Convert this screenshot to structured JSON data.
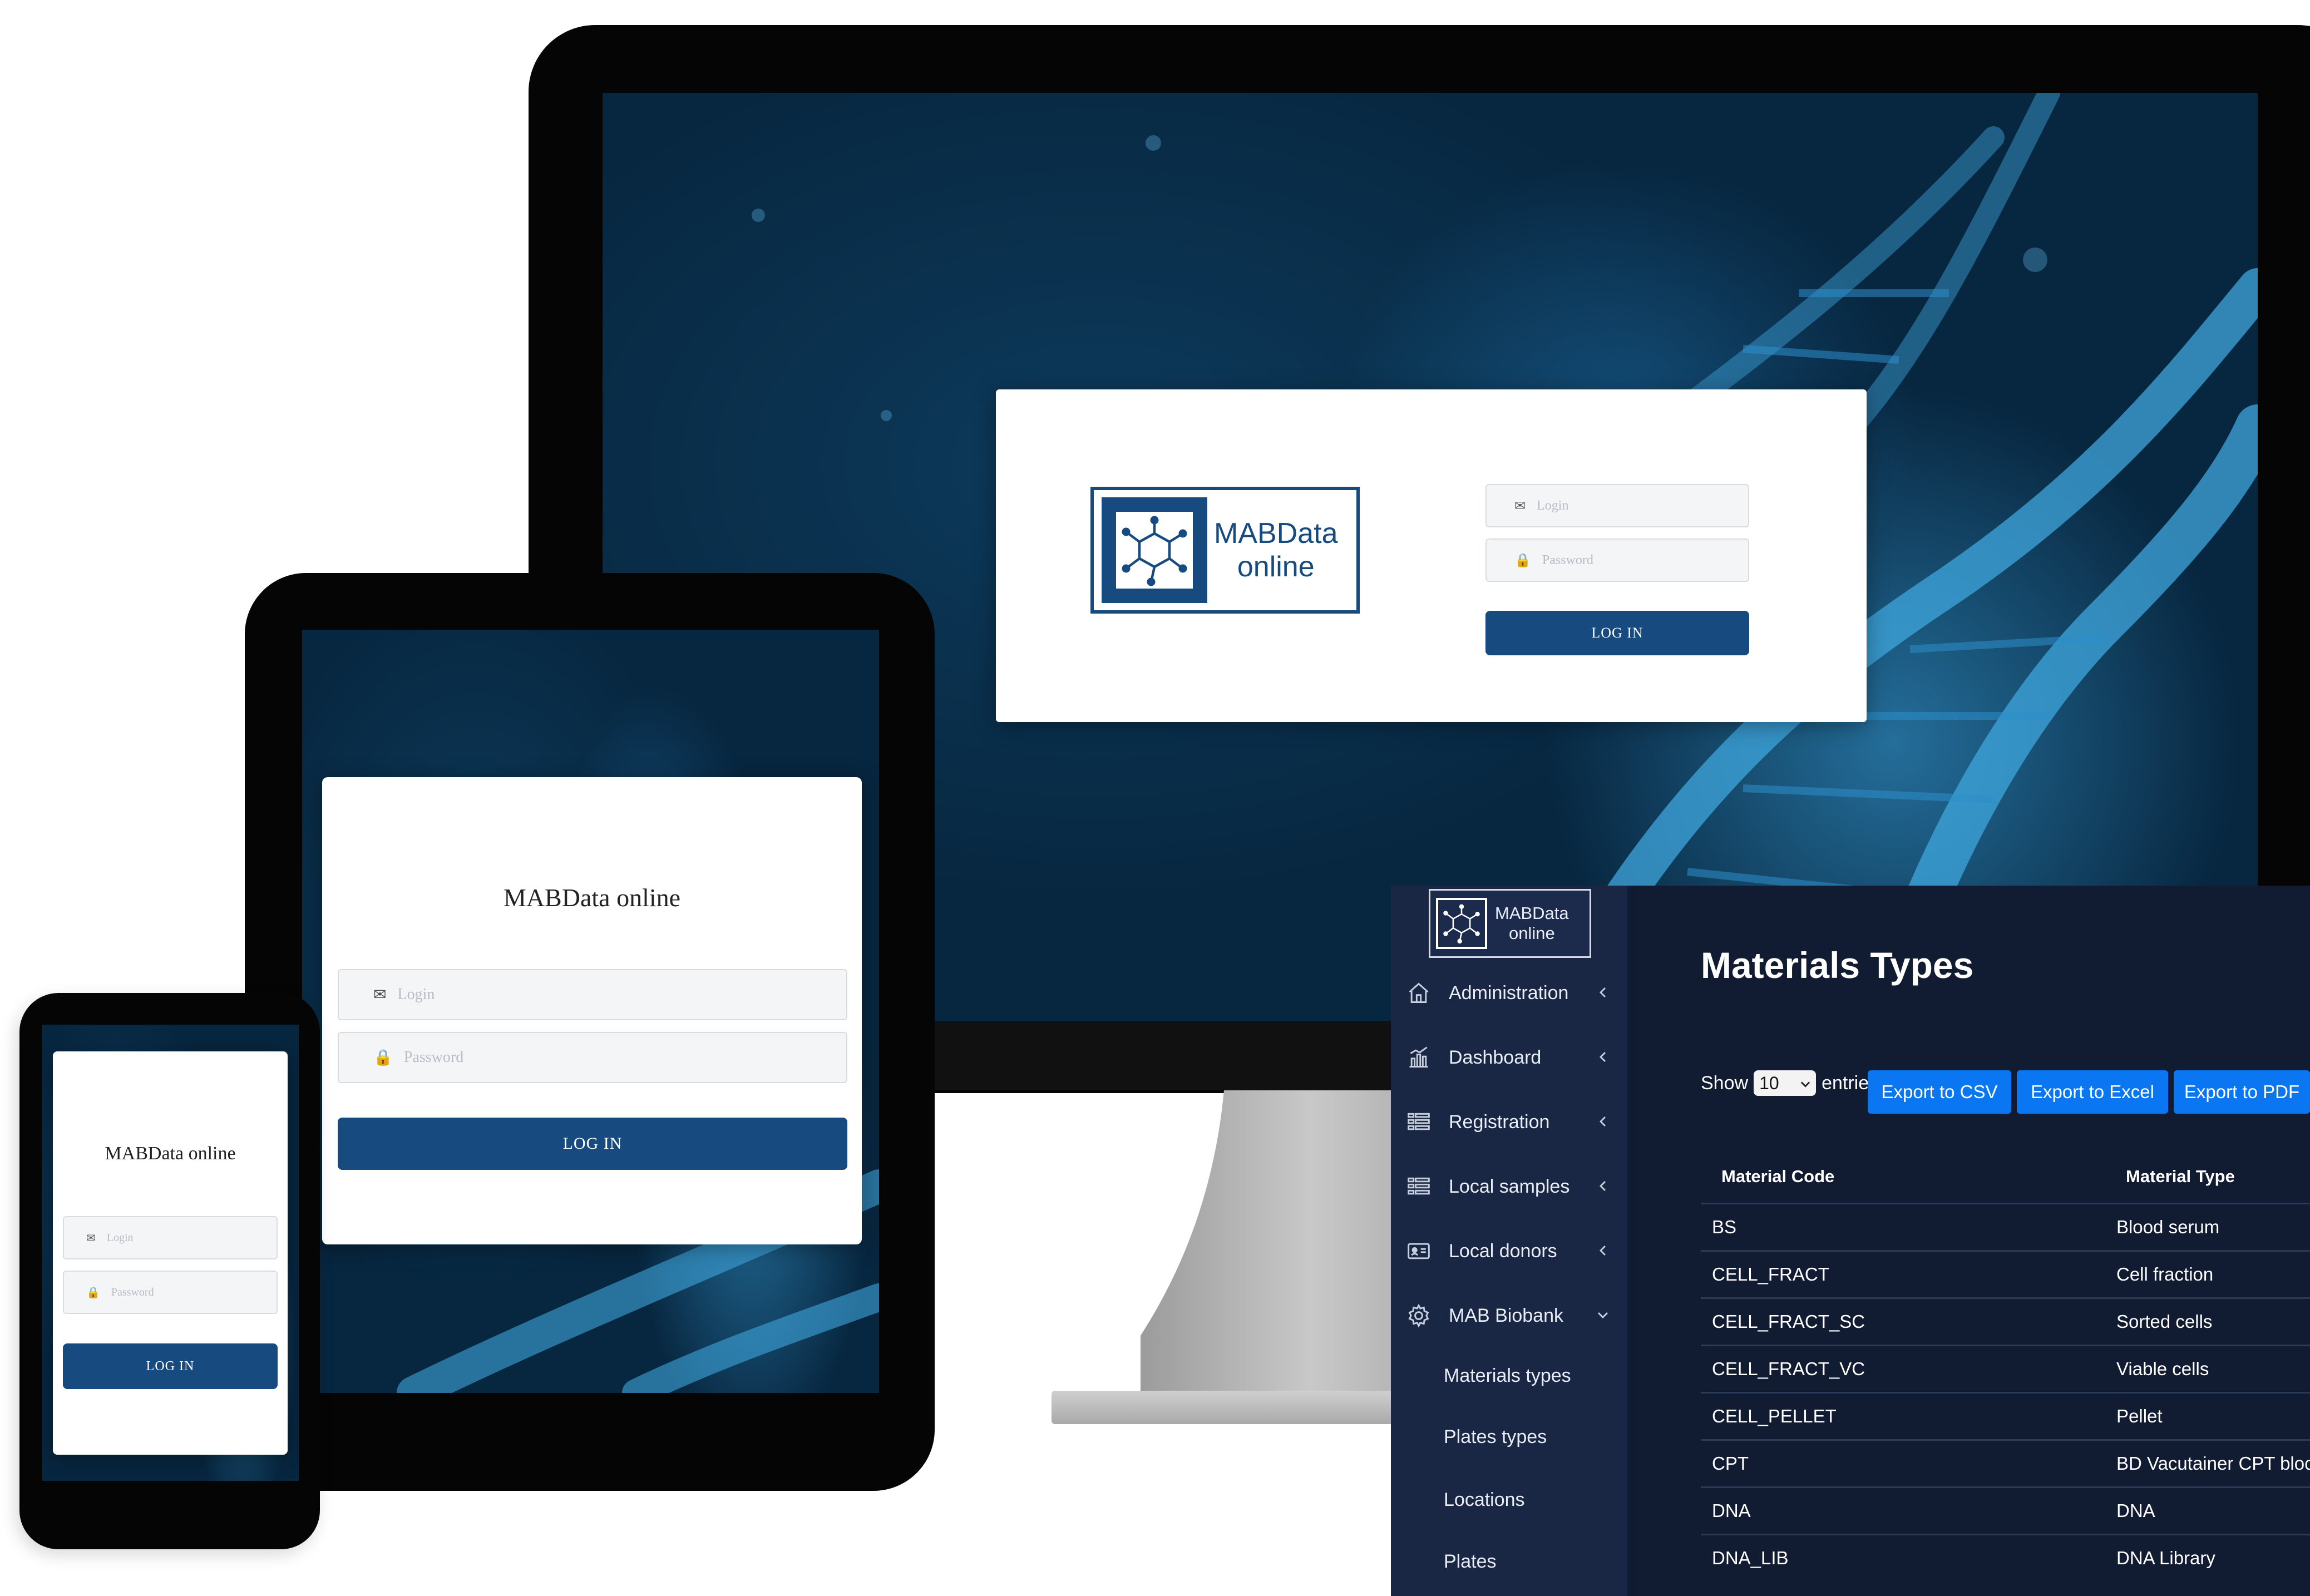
{
  "desktop": {
    "logo_text": "MABData\nonline",
    "logo_line1": "MABData",
    "logo_line2": "online",
    "login_placeholder": "Login",
    "password_placeholder": "Password",
    "login_button": "LOG IN"
  },
  "tablet": {
    "app_title": "MABData online",
    "login_placeholder": "Login",
    "password_placeholder": "Password",
    "login_button": "LOG IN"
  },
  "phone": {
    "app_title": "MABData online",
    "login_placeholder": "Login",
    "password_placeholder": "Password",
    "login_button": "LOG IN"
  },
  "admin": {
    "logo_line1": "MABData",
    "logo_line2": "online",
    "sidebar": {
      "items": [
        {
          "label": "Administration",
          "icon": "home-icon",
          "expanded": false
        },
        {
          "label": "Dashboard",
          "icon": "bar-chart-icon",
          "expanded": false
        },
        {
          "label": "Registration",
          "icon": "list-icon",
          "expanded": false
        },
        {
          "label": "Local samples",
          "icon": "list-icon",
          "expanded": false
        },
        {
          "label": "Local donors",
          "icon": "id-card-icon",
          "expanded": false
        },
        {
          "label": "MAB Biobank",
          "icon": "gear-icon",
          "expanded": true
        }
      ],
      "subitems": [
        "Materials types",
        "Plates types",
        "Locations",
        "Plates"
      ]
    },
    "page_title": "Materials Types",
    "show_label": "Show",
    "entries_value": "10",
    "entries_label": "entries",
    "export_buttons": [
      "Export to CSV",
      "Export to Excel",
      "Export to PDF"
    ],
    "table": {
      "columns": [
        "Material Code",
        "Material Type"
      ],
      "rows": [
        [
          "BS",
          "Blood serum"
        ],
        [
          "CELL_FRACT",
          "Cell fraction"
        ],
        [
          "CELL_FRACT_SC",
          "Sorted cells"
        ],
        [
          "CELL_FRACT_VC",
          "Viable cells"
        ],
        [
          "CELL_PELLET",
          "Pellet"
        ],
        [
          "CPT",
          "BD Vacutainer CPT bloc"
        ],
        [
          "DNA",
          "DNA"
        ],
        [
          "DNA_LIB",
          "DNA Library"
        ]
      ]
    }
  },
  "colors": {
    "brand_navy": "#174a7e",
    "panel_bg": "#0f1b33",
    "sidebar_bg": "#1a2744",
    "export_blue": "#0b76f2"
  }
}
